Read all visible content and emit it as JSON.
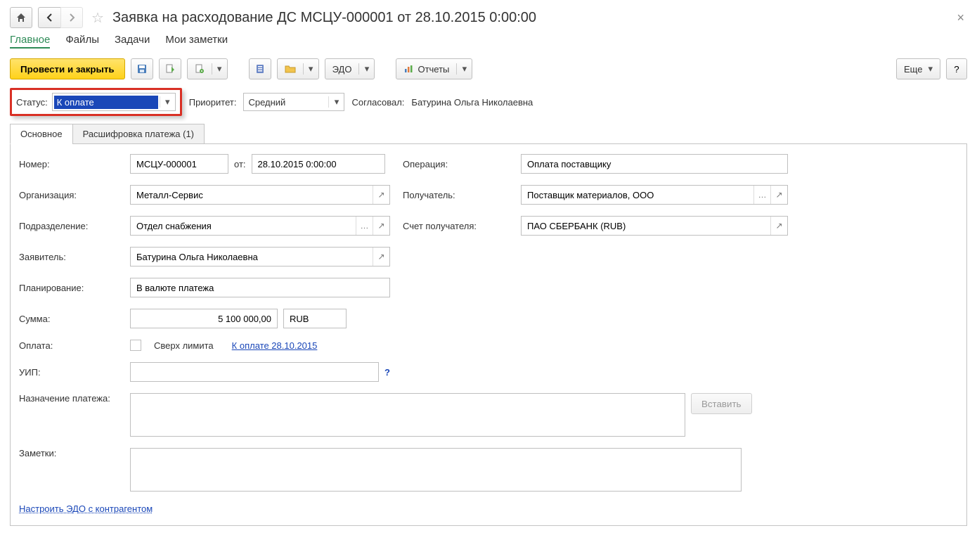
{
  "header": {
    "title": "Заявка на расходование ДС МСЦУ-000001 от 28.10.2015 0:00:00"
  },
  "nav": {
    "main": "Главное",
    "files": "Файлы",
    "tasks": "Задачи",
    "notes": "Мои заметки"
  },
  "toolbar": {
    "post_and_close": "Провести и закрыть",
    "edo": "ЭДО",
    "reports": "Отчеты",
    "more": "Еще"
  },
  "status_row": {
    "status_label": "Статус:",
    "status_value": "К оплате",
    "priority_label": "Приоритет:",
    "priority_value": "Средний",
    "approver_label": "Согласовал:",
    "approver_value": "Батурина Ольга Николаевна"
  },
  "tabs": {
    "main": "Основное",
    "detail": "Расшифровка платежа (1)"
  },
  "form": {
    "number_label": "Номер:",
    "number_value": "МСЦУ-000001",
    "date_label": "от:",
    "date_value": "28.10.2015 0:00:00",
    "operation_label": "Операция:",
    "operation_value": "Оплата поставщику",
    "org_label": "Организация:",
    "org_value": "Металл-Сервис",
    "recipient_label": "Получатель:",
    "recipient_value": "Поставщик материалов, ООО",
    "dept_label": "Подразделение:",
    "dept_value": "Отдел снабжения",
    "recip_acc_label": "Счет получателя:",
    "recip_acc_value": "ПАО СБЕРБАНК (RUB)",
    "applicant_label": "Заявитель:",
    "applicant_value": "Батурина Ольга Николаевна",
    "planning_label": "Планирование:",
    "planning_value": "В валюте платежа",
    "sum_label": "Сумма:",
    "sum_value": "5 100 000,00",
    "currency_value": "RUB",
    "payment_label": "Оплата:",
    "over_limit": "Сверх лимита",
    "pay_link": "К оплате 28.10.2015",
    "uip_label": "УИП:",
    "purpose_label": "Назначение платежа:",
    "insert_btn": "Вставить",
    "notes_label": "Заметки:"
  },
  "footer": {
    "edo_link": "Настроить ЭДО с контрагентом"
  }
}
